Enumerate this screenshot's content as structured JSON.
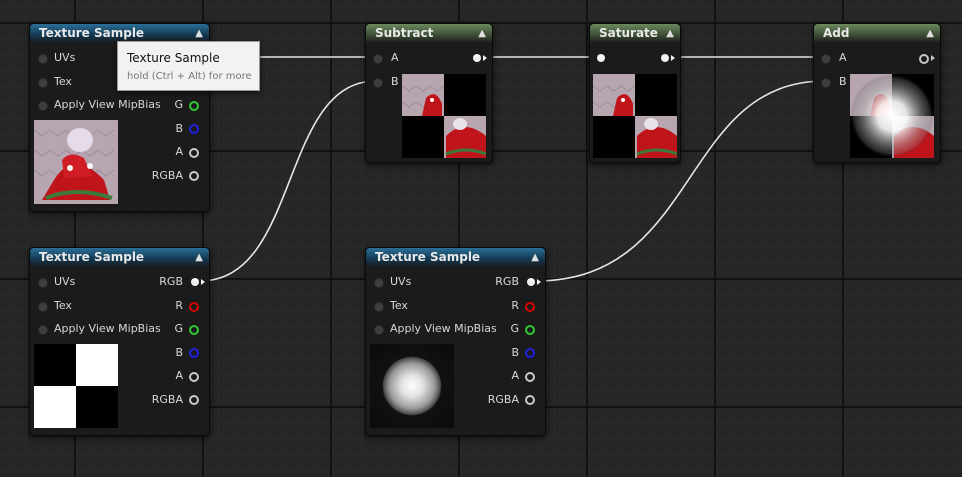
{
  "nodes": {
    "ts_top": {
      "title": "Texture Sample",
      "inputs": [
        "UVs",
        "Tex",
        "Apply View MipBias"
      ],
      "outputs": [
        "G",
        "B",
        "A",
        "RGBA"
      ]
    },
    "ts_left": {
      "title": "Texture Sample",
      "inputs": [
        "UVs",
        "Tex",
        "Apply View MipBias"
      ],
      "outputs": [
        "RGB",
        "R",
        "G",
        "B",
        "A",
        "RGBA"
      ]
    },
    "ts_mid": {
      "title": "Texture Sample",
      "inputs": [
        "UVs",
        "Tex",
        "Apply View MipBias"
      ],
      "outputs": [
        "RGB",
        "R",
        "G",
        "B",
        "A",
        "RGBA"
      ]
    },
    "subtract": {
      "title": "Subtract",
      "inputs": [
        "A",
        "B"
      ]
    },
    "saturate": {
      "title": "Saturate"
    },
    "add": {
      "title": "Add",
      "inputs": [
        "A",
        "B"
      ]
    }
  },
  "tooltip": {
    "title": "Texture Sample",
    "hint": "hold (Ctrl + Alt) for more"
  },
  "icons": {
    "collapse": "chevron-up-icon",
    "pin_connected": "filled-pin-icon",
    "pin_unconnected": "ring-pin-icon"
  },
  "colors": {
    "texture_header": "#2c6f98",
    "math_header": "#6a8a5e",
    "red_channel": "#d40000",
    "green_channel": "#2ec82e",
    "blue_channel": "#2020e0",
    "wire": "#e6e6e6"
  }
}
